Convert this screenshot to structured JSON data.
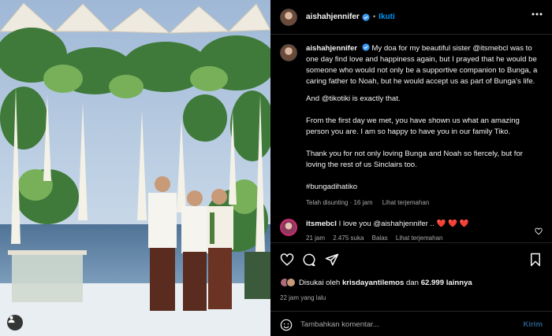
{
  "post": {
    "username": "aishahjennifer",
    "follow_label": "Ikuti",
    "more_icon": "more-horizontal-icon",
    "verified_icon": "verified-badge-icon"
  },
  "caption": {
    "username": "aishahjennifer",
    "p1": "My doa for my beautiful sister @itsmebcl was to one day find love and happiness again, but I prayed that he would be someone who would not only be a supportive companion to Bunga, a caring father to Noah, but he would accept us as part of Bunga's life.",
    "p2": "And @tikotiki is exactly that.",
    "p3": "From the first day we met, you have shown us what an amazing person you are. I am so happy to have you in our family Tiko.",
    "p4": "Thank you for not only loving Bunga and Noah so fiercely, but for loving the rest of us Sinclairs too.",
    "hashtag": "#bungadihatiko",
    "edited": "Telah disunting · 16 jam",
    "translate": "Lihat terjemahan"
  },
  "comment": {
    "username": "itsmebcl",
    "text": "I love you @aishahjennifer ..",
    "hearts": "❤️ ❤️ ❤️",
    "time": "21 jam",
    "likes": "2.475 suka",
    "reply": "Balas",
    "translate": "Lihat terjemahan"
  },
  "actions": {
    "icons": [
      "heart-icon",
      "comment-icon",
      "share-icon",
      "bookmark-icon"
    ],
    "liked_by_prefix": "Disukai oleh",
    "liked_by_user": "krisdayantilemos",
    "liked_by_and": "dan",
    "liked_by_count": "62.999 lainnya",
    "timestamp": "22 jam yang lalu"
  },
  "add_comment": {
    "placeholder": "Tambahkan komentar...",
    "send_label": "Kirim"
  },
  "colors": {
    "accent_blue": "#0095f6",
    "heart_red": "#ed4956",
    "muted": "#a8a8a8"
  }
}
